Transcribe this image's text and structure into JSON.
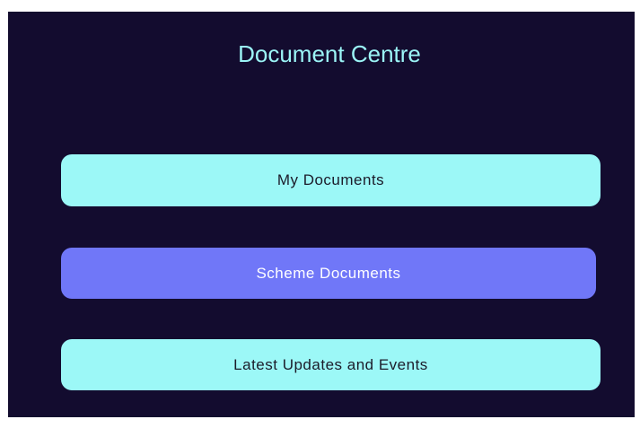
{
  "page": {
    "title": "Document Centre"
  },
  "menu": {
    "items": [
      {
        "label": "My Documents",
        "state": "default"
      },
      {
        "label": "Scheme Documents",
        "state": "active"
      },
      {
        "label": "Latest Updates and Events",
        "state": "default"
      }
    ]
  },
  "colors": {
    "background": "#130c2f",
    "title": "#9bf4f6",
    "button_default": "#9cf8f7",
    "button_active": "#7077f8"
  }
}
